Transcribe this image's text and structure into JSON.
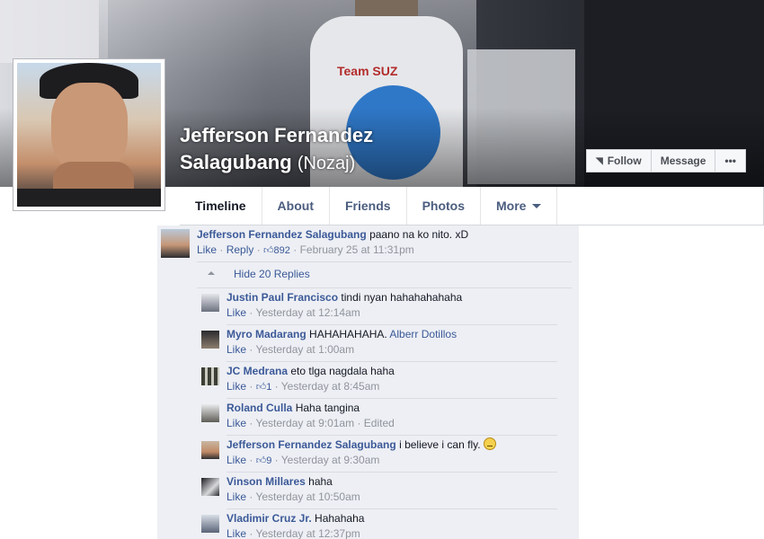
{
  "profile": {
    "name": "Jefferson Fernandez Salagubang",
    "name_line1": "Jefferson Fernandez",
    "name_line2": "Salagubang",
    "alternate_name": "(Nozaj)",
    "cover_shirt_text": "Team SUZ"
  },
  "actions": {
    "follow": "Follow",
    "message": "Message",
    "more": "•••"
  },
  "tabs": [
    {
      "label": "Timeline"
    },
    {
      "label": "About"
    },
    {
      "label": "Friends"
    },
    {
      "label": "Photos"
    },
    {
      "label": "More"
    }
  ],
  "main_comment": {
    "author": "Jefferson Fernandez Salagubang",
    "text": "paano na ko nito. xD",
    "like": "Like",
    "reply": "Reply",
    "likes": "892",
    "time": "February 25 at 11:31pm"
  },
  "hide_replies": "Hide 20 Replies",
  "replies": [
    {
      "author": "Justin Paul Francisco",
      "text": "tindi nyan hahahahahaha",
      "like": "Like",
      "likes": "",
      "time": "Yesterday at 12:14am",
      "edited": ""
    },
    {
      "author": "Myro Madarang",
      "text": "HAHAHAHAHA.",
      "mention": "Alberr Dotillos",
      "like": "Like",
      "likes": "",
      "time": "Yesterday at 1:00am",
      "edited": ""
    },
    {
      "author": "JC Medrana",
      "text": "eto tlga nagdala haha",
      "like": "Like",
      "likes": "1",
      "time": "Yesterday at 8:45am",
      "edited": ""
    },
    {
      "author": "Roland Culla",
      "text": "Haha tangina",
      "like": "Like",
      "likes": "",
      "time": "Yesterday at 9:01am",
      "edited": "Edited"
    },
    {
      "author": "Jefferson Fernandez Salagubang",
      "text": "i believe i can fly.",
      "like": "Like",
      "likes": "9",
      "time": "Yesterday at 9:30am",
      "edited": ""
    },
    {
      "author": "Vinson Millares",
      "text": "haha",
      "like": "Like",
      "likes": "",
      "time": "Yesterday at 10:50am",
      "edited": ""
    },
    {
      "author": "Vladimir Cruz Jr.",
      "text": "Hahahaha",
      "like": "Like",
      "likes": "",
      "time": "Yesterday at 12:37pm",
      "edited": ""
    }
  ]
}
